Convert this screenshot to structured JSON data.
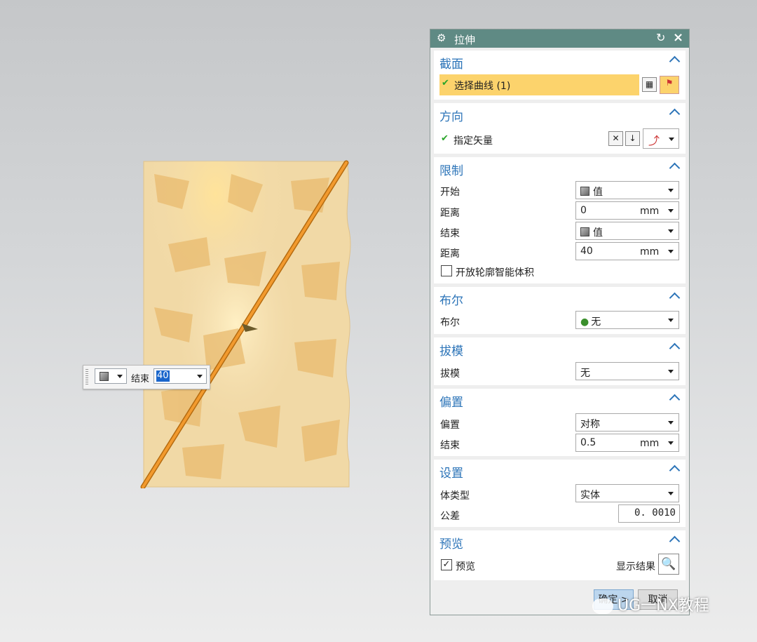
{
  "dialog": {
    "title": "拉伸",
    "groups": {
      "section": {
        "title": "截面",
        "select_curve": "选择曲线 (1)"
      },
      "direction": {
        "title": "方向",
        "specify_vector": "指定矢量"
      },
      "limits": {
        "title": "限制",
        "start_label": "开始",
        "start_value": "值",
        "start_distance_label": "距离",
        "start_distance": "0",
        "start_unit": "mm",
        "end_label": "结束",
        "end_value": "值",
        "end_distance_label": "距离",
        "end_distance": "40",
        "end_unit": "mm",
        "open_profile_label": "开放轮廓智能体积",
        "open_profile_checked": false
      },
      "boolean": {
        "title": "布尔",
        "label": "布尔",
        "value": "无"
      },
      "draft": {
        "title": "拔模",
        "label": "拔模",
        "value": "无"
      },
      "offset": {
        "title": "偏置",
        "label": "偏置",
        "value": "对称",
        "end_label": "结束",
        "end_value": "0.5",
        "end_unit": "mm"
      },
      "settings": {
        "title": "设置",
        "body_type_label": "体类型",
        "body_type_value": "实体",
        "tolerance_label": "公差",
        "tolerance_value": "0. 0010"
      },
      "preview": {
        "title": "预览",
        "preview_label": "预览",
        "preview_checked": true,
        "show_result_label": "显示结果"
      }
    },
    "buttons": {
      "ok": "确定 >",
      "cancel": "取消"
    }
  },
  "float_bar": {
    "label": "结束",
    "value": "40"
  },
  "watermark": "UG一NX教程",
  "colors": {
    "title_bar": "#5f8a84",
    "group_title": "#2c74b8",
    "section_highlight": "#fcd36c",
    "curve": "#f29a2e",
    "surface": "#f1d9a6"
  }
}
